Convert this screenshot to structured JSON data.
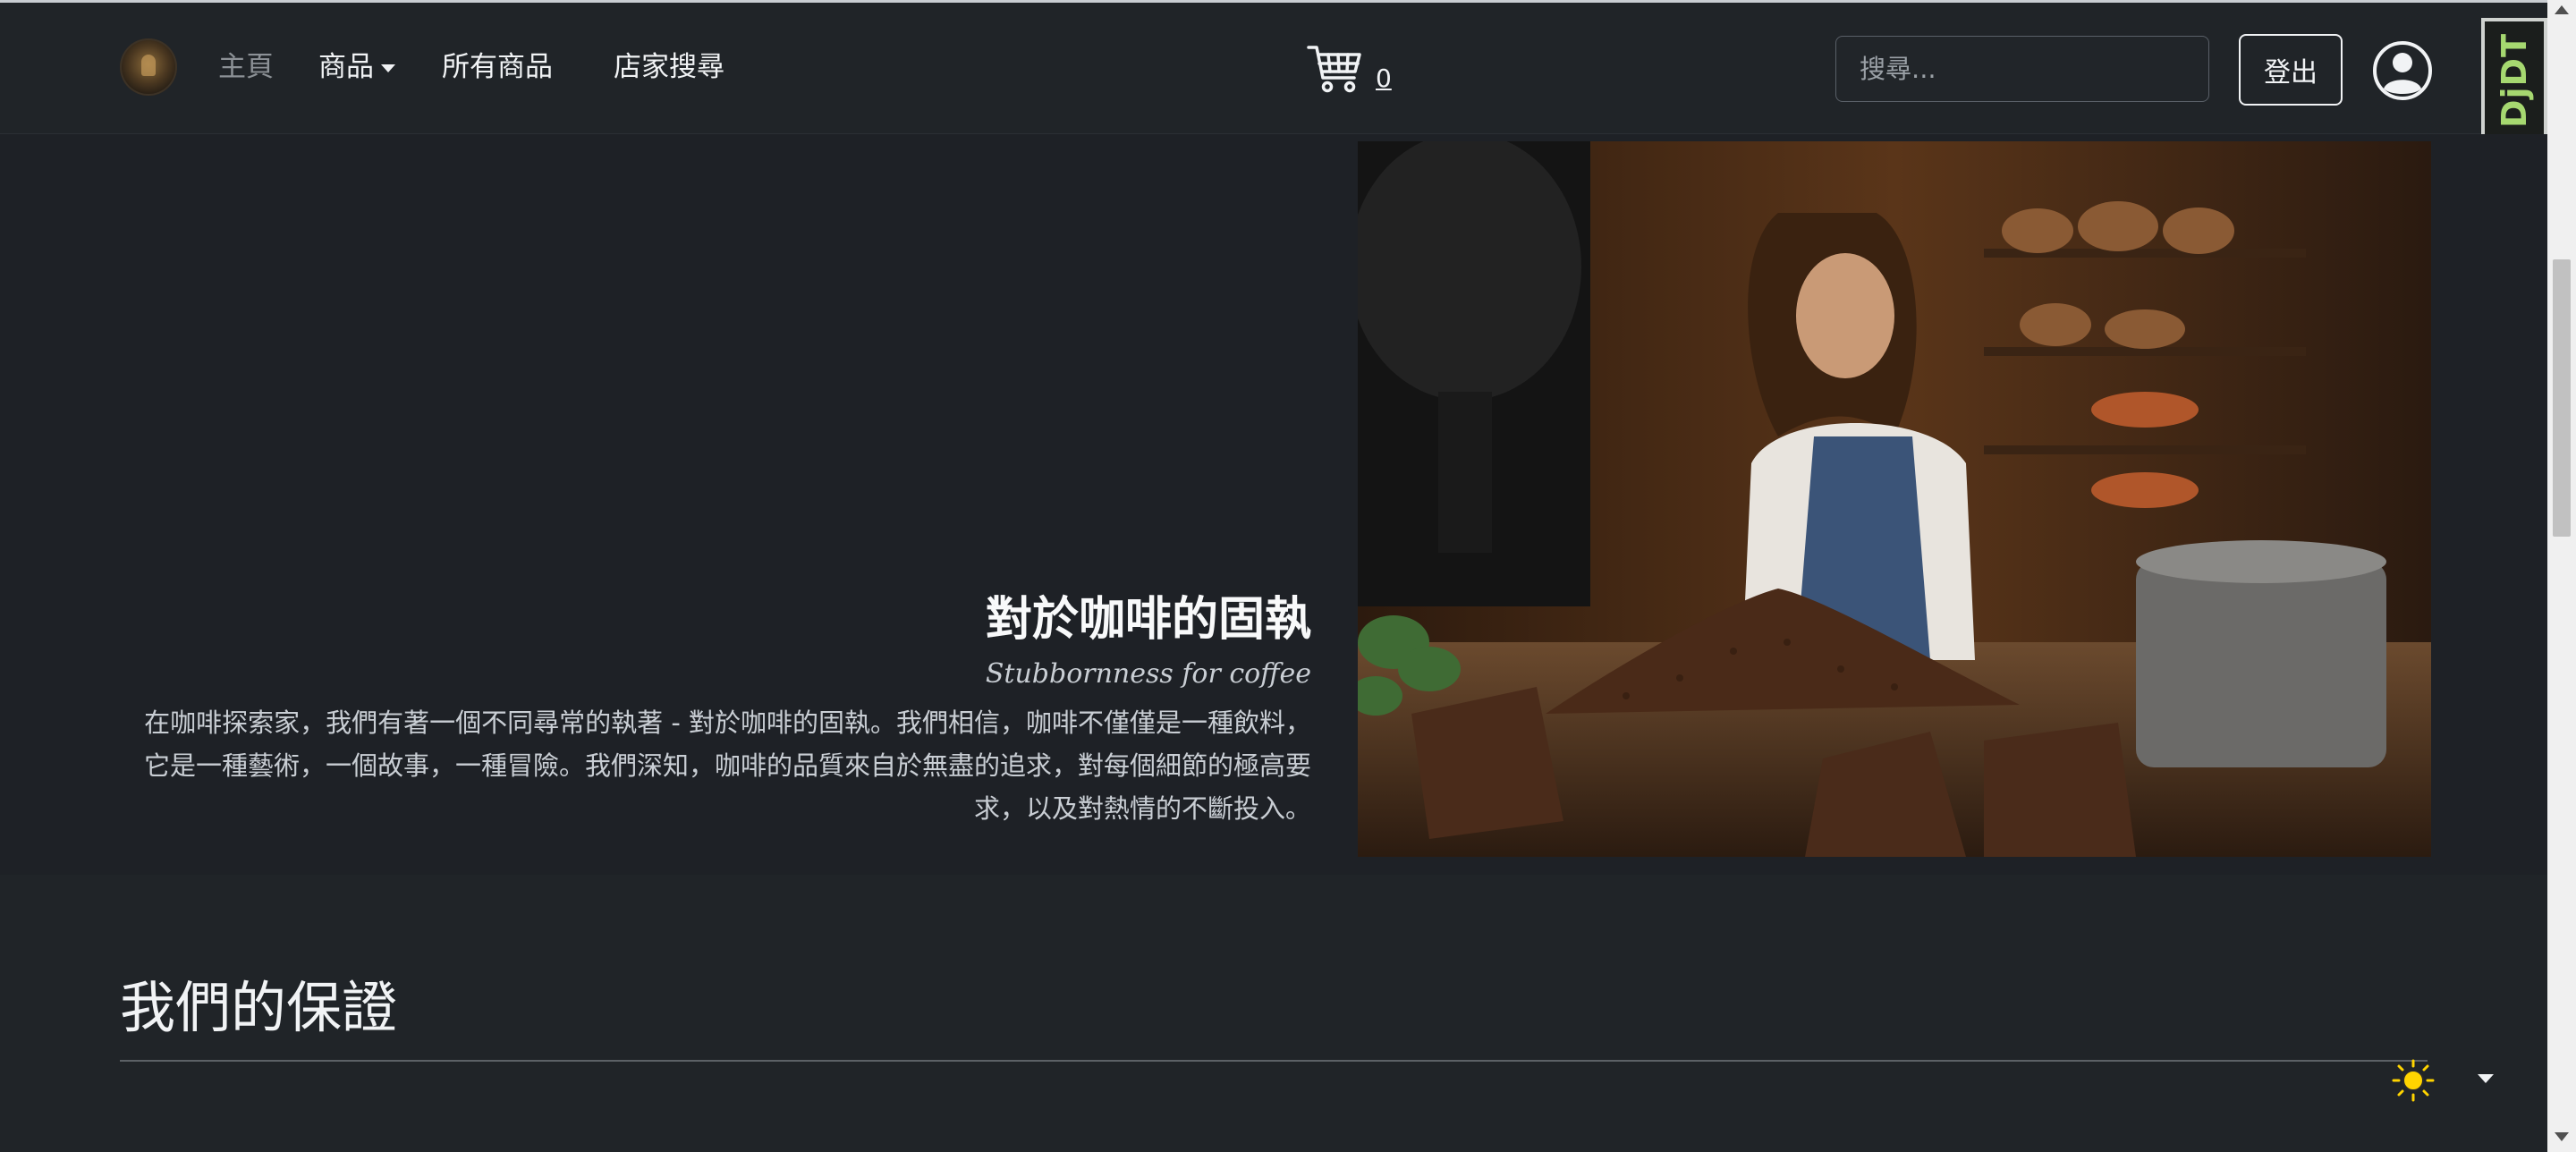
{
  "navbar": {
    "logo_icon": "coffee-logo-icon",
    "items": [
      {
        "label": "主頁",
        "active": true
      },
      {
        "label": "商品",
        "dropdown": true
      },
      {
        "label": "所有商品"
      },
      {
        "label": "店家搜尋"
      }
    ],
    "cart_icon": "cart-icon",
    "cart_count": "0",
    "search_placeholder": "搜尋...",
    "search_value": "",
    "logout_label": "登出",
    "user_icon": "user-avatar-icon"
  },
  "debug_toolbar": {
    "label": "DjDT"
  },
  "hero": {
    "title": "對於咖啡的固執",
    "subtitle": "Stubbornness for coffee",
    "description": "在咖啡探索家，我們有著一個不同尋常的執著 - 對於咖啡的固執。我們相信，咖啡不僅僅是一種飲料，它是一種藝術，一個故事，一種冒險。我們深知，咖啡的品質來自於無盡的追求，對每個細節的極高要求，以及對熱情的不斷投入。"
  },
  "section": {
    "title": "我們的保證",
    "theme_icon": "sun-icon"
  },
  "colors": {
    "navbar_bg": "#202428",
    "hero_bg": "#1e2126",
    "text": "#e9ecef",
    "muted": "#8c9196",
    "sun": "#ffd400"
  }
}
